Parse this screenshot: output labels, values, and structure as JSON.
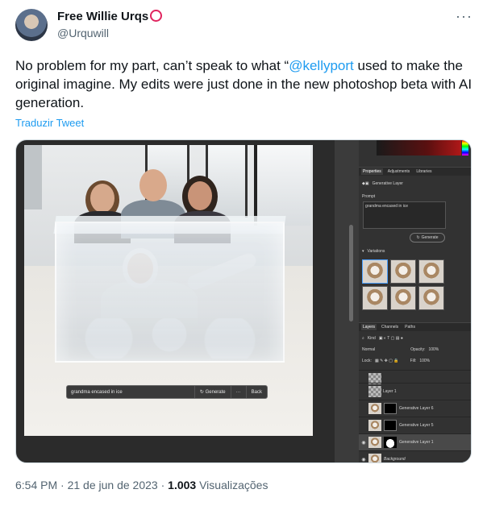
{
  "author": {
    "name": "Free Willie Urqs",
    "handle": "@Urquwill"
  },
  "more_label": "···",
  "tweet": {
    "text_before": "No problem for my part, can’t speak to what “",
    "mention": "@kellyport",
    "text_after": " used to make the original imagine. My edits were just done in the new photoshop beta with AI generation.",
    "translate_label": "Traduzir Tweet"
  },
  "canvas": {
    "prompt_value": "grandma encased in ice",
    "generate_label": "Generate",
    "more_label": "···",
    "back_label": "Back"
  },
  "ps_panel": {
    "tabs": [
      "Properties",
      "Adjustments",
      "Libraries"
    ],
    "layer_type": "Generative Layer",
    "prompt_label": "Prompt",
    "prompt_value": "grandma encased in ice",
    "generate_label": "Generate",
    "variations_label": "Variations",
    "layers_tabs": [
      "Layers",
      "Channels",
      "Paths"
    ],
    "kind_label": "Kind",
    "blend_mode": "Normal",
    "opacity_label": "Opacity:",
    "opacity_value": "100%",
    "lock_label": "Lock:",
    "fill_label": "Fill:",
    "fill_value": "100%",
    "layers": [
      {
        "name": "Layer 1"
      },
      {
        "name": "Generative Layer 6"
      },
      {
        "name": "Generative Layer 5"
      },
      {
        "name": "Generative Layer 1"
      },
      {
        "name": "Background"
      }
    ]
  },
  "meta": {
    "time": "6:54 PM",
    "date": "21 de jun de 2023",
    "views_count": "1.003",
    "views_label": "Visualizações"
  }
}
